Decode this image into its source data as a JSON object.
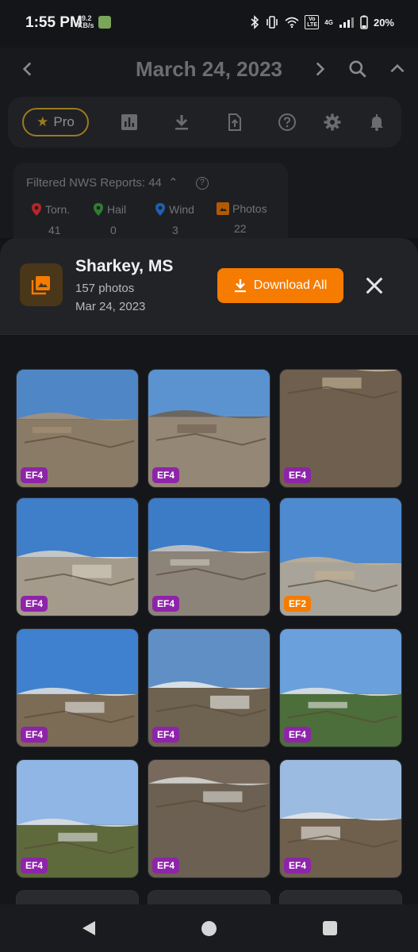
{
  "status_bar": {
    "time": "1:55 PM",
    "net_speed_value": "39.2",
    "net_speed_unit": "KB/s",
    "network_type": "4G",
    "volte": "Vo LTE",
    "battery": "20%"
  },
  "header": {
    "date": "March 24, 2023"
  },
  "toolbar": {
    "pro_label": "Pro",
    "icons": [
      "bar-chart-icon",
      "download-icon",
      "upload-icon",
      "help-icon",
      "settings-icon",
      "bell-icon"
    ]
  },
  "filter_card": {
    "title": "Filtered NWS Reports: 44",
    "columns": [
      {
        "label": "Torn.",
        "value": "41",
        "color": "#c62828"
      },
      {
        "label": "Hail",
        "value": "0",
        "color": "#2e7d32"
      },
      {
        "label": "Wind",
        "value": "3",
        "color": "#1565c0"
      },
      {
        "label": "Photos",
        "value": "22",
        "color": "#e65100"
      }
    ]
  },
  "sheet": {
    "location": "Sharkey, MS",
    "photo_count": "157 photos",
    "date": "Mar 24, 2023",
    "download_label": "Download All",
    "accent": "#f57c00"
  },
  "photos": [
    {
      "rating": "EF4",
      "badge_color": "#8e24aa",
      "scene": "debris-pile"
    },
    {
      "rating": "EF4",
      "badge_color": "#8e24aa",
      "scene": "slab-debris"
    },
    {
      "rating": "EF4",
      "badge_color": "#8e24aa",
      "scene": "concrete-closeup"
    },
    {
      "rating": "EF4",
      "badge_color": "#8e24aa",
      "scene": "flipped-trailer"
    },
    {
      "rating": "EF4",
      "badge_color": "#8e24aa",
      "scene": "flipped-trailer-2"
    },
    {
      "rating": "EF2",
      "badge_color": "#f57c00",
      "scene": "damaged-building"
    },
    {
      "rating": "EF4",
      "badge_color": "#8e24aa",
      "scene": "fallen-tank"
    },
    {
      "rating": "EF4",
      "badge_color": "#8e24aa",
      "scene": "tank-closeup"
    },
    {
      "rating": "EF4",
      "badge_color": "#8e24aa",
      "scene": "tank-on-grass"
    },
    {
      "rating": "EF4",
      "badge_color": "#8e24aa",
      "scene": "tank-cone"
    },
    {
      "rating": "EF4",
      "badge_color": "#8e24aa",
      "scene": "ground-debris"
    },
    {
      "rating": "EF4",
      "badge_color": "#8e24aa",
      "scene": "tank-pieces"
    }
  ]
}
